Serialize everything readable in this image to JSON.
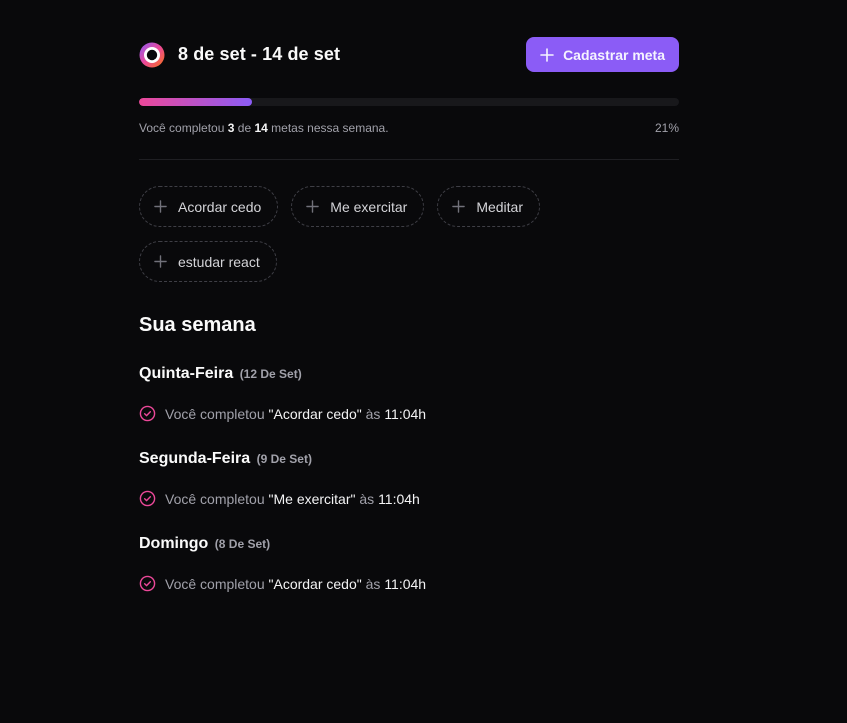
{
  "header": {
    "week_range": "8 de set - 14 de set",
    "create_button_label": "Cadastrar meta",
    "logo_icon": "ring-logo-icon"
  },
  "progress": {
    "prefix": "Você completou",
    "completed": "3",
    "connector": "de",
    "total": "14",
    "suffix": "metas nessa semana.",
    "percent_label": "21%",
    "fraction": 0.21
  },
  "goals": [
    {
      "label": "Acordar cedo"
    },
    {
      "label": "Me exercitar"
    },
    {
      "label": "Meditar"
    },
    {
      "label": "estudar react"
    }
  ],
  "summary": {
    "title": "Sua semana",
    "days": [
      {
        "weekday": "Quinta-Feira",
        "date": "(12 De Set)",
        "entries": [
          {
            "prefix": "Você completou",
            "goal": "\"Acordar cedo\"",
            "connector": "às",
            "time": "11:04h"
          }
        ]
      },
      {
        "weekday": "Segunda-Feira",
        "date": "(9 De Set)",
        "entries": [
          {
            "prefix": "Você completou",
            "goal": "\"Me exercitar\"",
            "connector": "às",
            "time": "11:04h"
          }
        ]
      },
      {
        "weekday": "Domingo",
        "date": "(8 De Set)",
        "entries": [
          {
            "prefix": "Você completou",
            "goal": "\"Acordar cedo\"",
            "connector": "às",
            "time": "11:04h"
          }
        ]
      }
    ]
  },
  "colors": {
    "background": "#09090b",
    "accent": "#8b5cf6",
    "pink": "#ec4899",
    "muted": "#a1a1aa"
  }
}
